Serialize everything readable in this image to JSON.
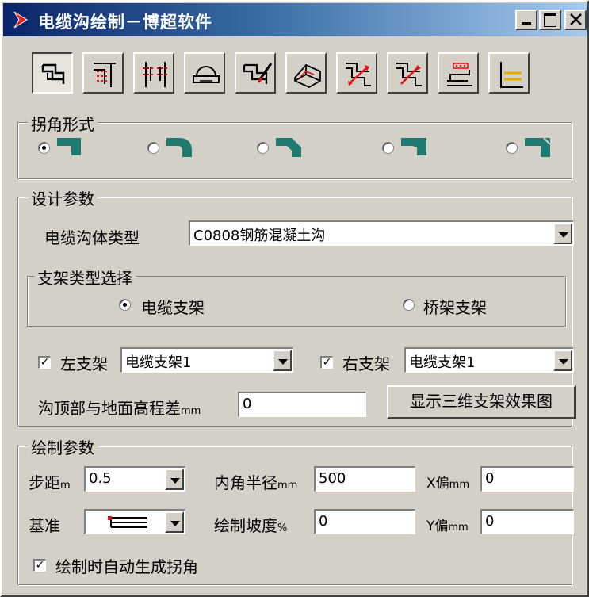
{
  "window": {
    "title": "电缆沟绘制－博超软件"
  },
  "toolbar": {
    "tools": [
      "tool-1",
      "tool-2",
      "tool-3",
      "tool-4",
      "tool-5",
      "tool-6",
      "tool-7",
      "tool-8",
      "tool-9",
      "tool-10"
    ]
  },
  "corner_group": {
    "legend": "拐角形式",
    "selected_index": 0,
    "options": [
      "square-corner",
      "rounded-corner",
      "chamfer-corner",
      "bevel-corner",
      "step-corner"
    ]
  },
  "design_group": {
    "legend": "设计参数",
    "trench_type_label": "电缆沟体类型",
    "trench_type_value": "C0808钢筋混凝土沟",
    "support_type_group": {
      "legend": "支架类型选择",
      "options": [
        "电缆支架",
        "桥架支架"
      ],
      "selected": "电缆支架"
    },
    "left_support": {
      "label": "左支架",
      "checked": true,
      "value": "电缆支架1"
    },
    "right_support": {
      "label": "右支架",
      "checked": true,
      "value": "电缆支架1"
    },
    "elevation_label": "沟顶部与地面高程差",
    "elevation_unit": "mm",
    "elevation_value": "0",
    "show_3d_button": "显示三维支架效果图"
  },
  "draw_group": {
    "legend": "绘制参数",
    "step_label": "步距",
    "step_unit": "m",
    "step_value": "0.5",
    "inner_radius_label": "内角半径",
    "inner_radius_unit": "mm",
    "inner_radius_value": "500",
    "x_offset_label": "X偏",
    "x_offset_unit": "mm",
    "x_offset_value": "0",
    "base_label": "基准",
    "slope_label": "绘制坡度",
    "slope_unit": "%",
    "slope_value": "0",
    "y_offset_label": "Y偏",
    "y_offset_unit": "mm",
    "y_offset_value": "0",
    "auto_corner_label": "绘制时自动生成拐角",
    "auto_corner_checked": true
  },
  "colors": {
    "teal_shape": "#1f7a70",
    "red_marker": "#d81010"
  }
}
